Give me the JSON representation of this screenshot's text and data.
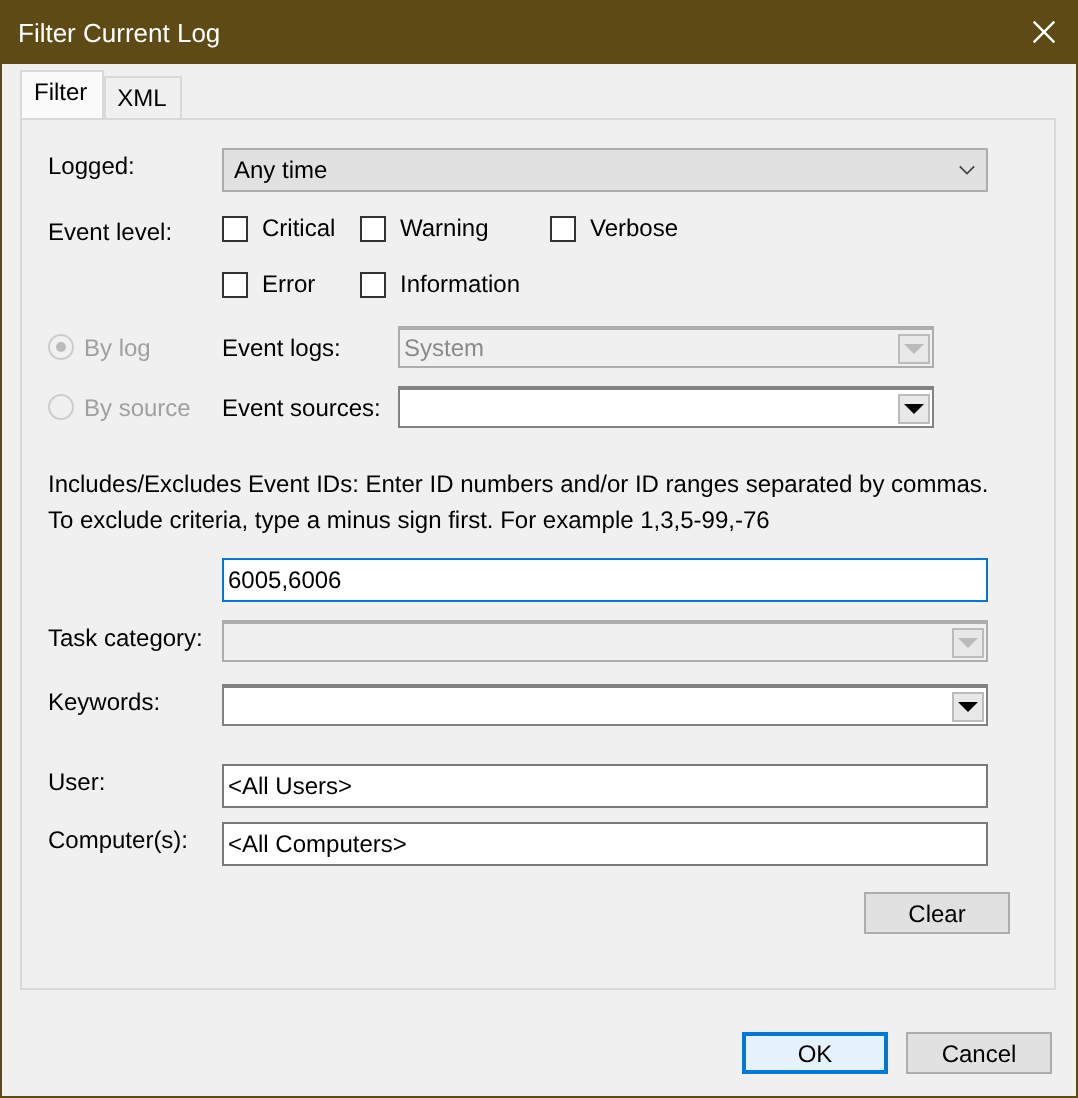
{
  "window": {
    "title": "Filter Current Log"
  },
  "tabs": [
    {
      "label": "Filter",
      "selected": true
    },
    {
      "label": "XML",
      "selected": false
    }
  ],
  "logged": {
    "label": "Logged:",
    "value": "Any time"
  },
  "event_level": {
    "label": "Event level:",
    "options": [
      {
        "label": "Critical",
        "checked": false
      },
      {
        "label": "Warning",
        "checked": false
      },
      {
        "label": "Verbose",
        "checked": false
      },
      {
        "label": "Error",
        "checked": false
      },
      {
        "label": "Information",
        "checked": false
      }
    ]
  },
  "source_modes": [
    {
      "label": "By log",
      "selected": true,
      "disabled": true,
      "field": {
        "label": "Event logs:",
        "value": "System",
        "disabled": true
      }
    },
    {
      "label": "By source",
      "selected": false,
      "disabled": true,
      "field": {
        "label": "Event sources:",
        "disabled": false
      }
    }
  ],
  "event_ids": {
    "description": "Includes/Excludes Event IDs: Enter ID numbers and/or ID ranges separated by commas. To exclude criteria, type a minus sign first. For example 1,3,5-99,-76",
    "value": "6005,6006"
  },
  "task_category": {
    "label": "Task category:",
    "disabled": true
  },
  "keywords": {
    "label": "Keywords:",
    "disabled": false
  },
  "user": {
    "label": "User:",
    "value": "<All Users>"
  },
  "computers": {
    "label": "Computer(s):",
    "value": "<All Computers>"
  },
  "clear_button": "Clear",
  "buttons": [
    {
      "label": "OK",
      "default": true
    },
    {
      "label": "Cancel",
      "default": false
    }
  ]
}
